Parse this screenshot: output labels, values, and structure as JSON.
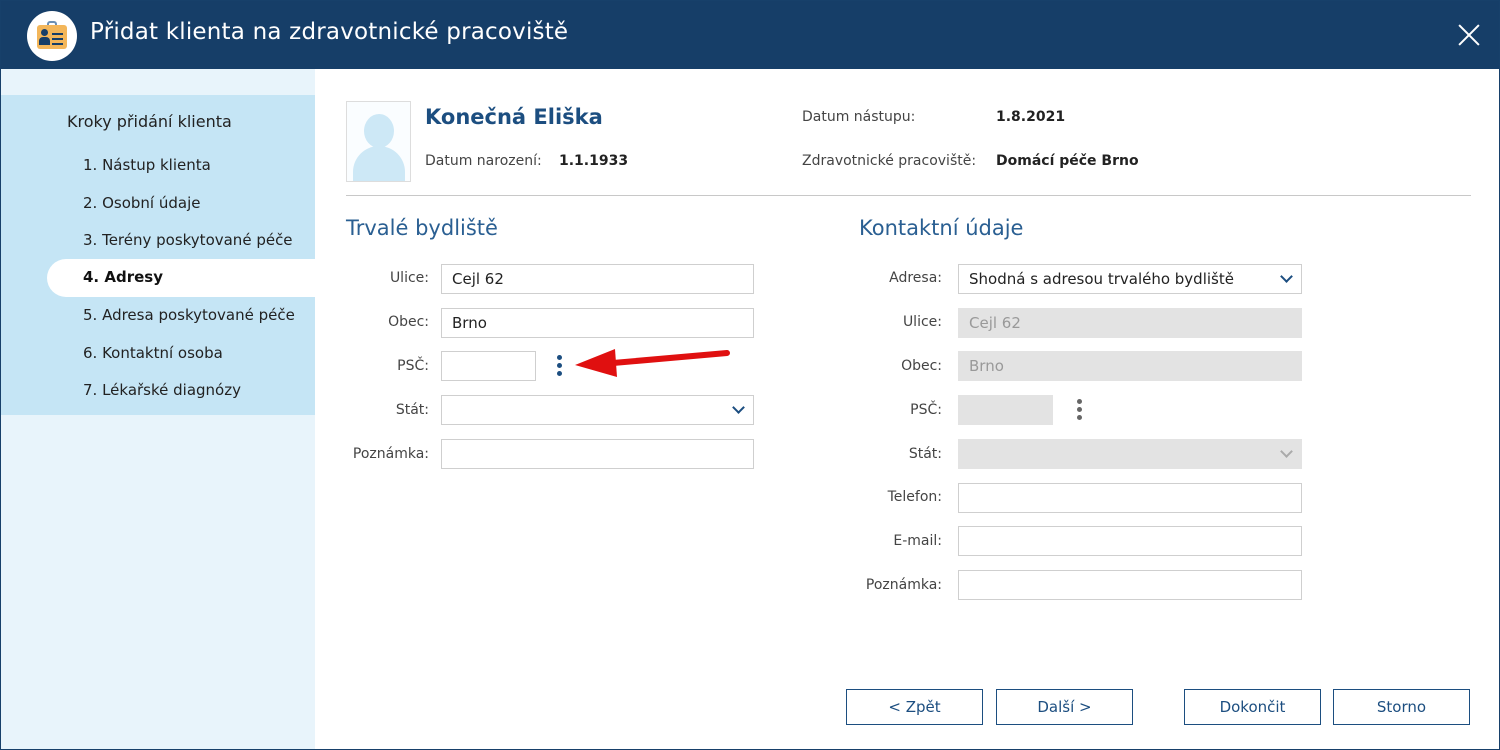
{
  "window": {
    "title": "Přidat klienta na zdravotnické pracoviště"
  },
  "sidebar": {
    "title": "Kroky přidání klienta",
    "steps": [
      "1. Nástup klienta",
      "2. Osobní údaje",
      "3. Terény poskytované péče",
      "4. Adresy",
      "5. Adresa poskytované péče",
      "6. Kontaktní osoba",
      "7. Lékařské diagnózy"
    ],
    "active_index": 3
  },
  "client": {
    "name": "Konečná Eliška",
    "birth_label": "Datum narození:",
    "birth_value": "1.1.1933",
    "start_label": "Datum nástupu:",
    "start_value": "1.8.2021",
    "workplace_label": "Zdravotnické pracoviště:",
    "workplace_value": "Domácí péče Brno"
  },
  "permanent": {
    "title": "Trvalé bydliště",
    "street_label": "Ulice:",
    "street_value": "Cejl 62",
    "city_label": "Obec:",
    "city_value": "Brno",
    "zip_label": "PSČ:",
    "zip_value": "",
    "country_label": "Stát:",
    "country_value": "",
    "note_label": "Poznámka:",
    "note_value": ""
  },
  "contact": {
    "title": "Kontaktní údaje",
    "address_label": "Adresa:",
    "address_value": "Shodná s adresou trvalého bydliště",
    "street_label": "Ulice:",
    "street_value": "Cejl 62",
    "city_label": "Obec:",
    "city_value": "Brno",
    "zip_label": "PSČ:",
    "zip_value": "",
    "country_label": "Stát:",
    "country_value": "",
    "phone_label": "Telefon:",
    "phone_value": "",
    "email_label": "E-mail:",
    "email_value": "",
    "note_label": "Poznámka:",
    "note_value": ""
  },
  "buttons": {
    "back": "< Zpět",
    "next": "Další >",
    "finish": "Dokončit",
    "cancel": "Storno"
  },
  "colors": {
    "titlebar": "#163e68",
    "sidebar": "#c5e5f5",
    "accent": "#1c4e80",
    "annotation_arrow": "#e01010"
  },
  "icons": {
    "app": "client-card-icon",
    "close": "close-icon",
    "zip_menu": "more-vertical-icon",
    "dropdown": "chevron-down-icon"
  }
}
